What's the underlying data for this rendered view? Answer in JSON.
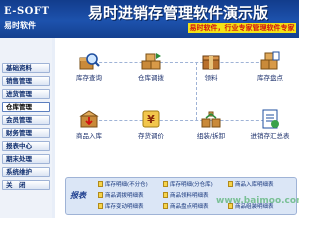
{
  "header": {
    "brand": "E-SOFT",
    "brand_sub": "易时软件",
    "title": "易时进销存管理软件演示版",
    "promo": "易时软件，行业专家管理软件专家"
  },
  "sidebar": {
    "items": [
      {
        "label": "基础资料"
      },
      {
        "label": "销售管理"
      },
      {
        "label": "进货管理"
      },
      {
        "label": "仓库管理"
      },
      {
        "label": "会员管理"
      },
      {
        "label": "财务管理"
      },
      {
        "label": "报表中心"
      },
      {
        "label": "期末处理"
      },
      {
        "label": "系统维护"
      },
      {
        "label": "关　闭"
      }
    ],
    "active_index": 3
  },
  "main": {
    "tiles": [
      {
        "label": "库存查询",
        "icon": "magnifier-box-icon"
      },
      {
        "label": "仓库调拨",
        "icon": "transfer-icon"
      },
      {
        "label": "领料",
        "icon": "materials-icon"
      },
      {
        "label": "库存盘点",
        "icon": "inventory-check-icon"
      },
      {
        "label": "商品入库",
        "icon": "stock-in-icon"
      },
      {
        "label": "存货调价",
        "icon": "price-adjust-icon"
      },
      {
        "label": "组装/拆卸",
        "icon": "assemble-icon"
      },
      {
        "label": "进销存汇总表",
        "icon": "summary-report-icon"
      }
    ]
  },
  "reports": {
    "title": "报表",
    "links": [
      {
        "label": "库存明细(不分仓)"
      },
      {
        "label": "库存明细(分仓库)"
      },
      {
        "label": "商品入库明细表"
      },
      {
        "label": "商品调拨明细表"
      },
      {
        "label": "商品领料明细表"
      },
      {
        "label": "库存变动明细表"
      },
      {
        "label": "商品盘点明细表"
      },
      {
        "label": "商品组装明细表"
      }
    ]
  },
  "watermark": "www.baimoo.com",
  "colors": {
    "header_blue": "#1d52ad",
    "promo_yellow": "#f3e216",
    "promo_red": "#d01212",
    "panel_blue": "#dbe6f6"
  }
}
